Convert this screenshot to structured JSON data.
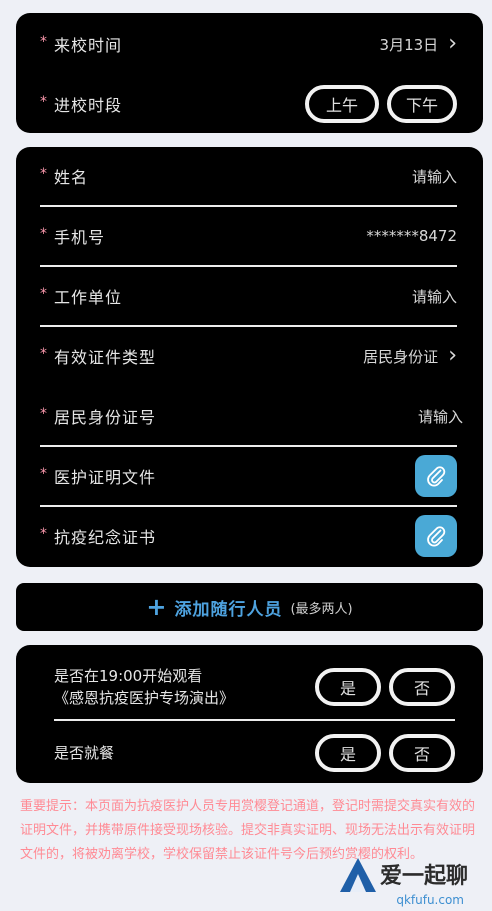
{
  "visit_card": {
    "date_label": "来校时间",
    "date_value": "3月13日",
    "period_label": "进校时段",
    "period_options": [
      "上午",
      "下午"
    ]
  },
  "info_card": {
    "name_label": "姓名",
    "name_placeholder": "请输入",
    "phone_label": "手机号",
    "phone_value": "*******8472",
    "workplace_label": "工作单位",
    "workplace_placeholder": "请输入",
    "id_type_label": "有效证件类型",
    "id_type_value": "居民身份证",
    "id_number_label": "居民身份证号",
    "id_number_placeholder": "请输入",
    "medical_proof_label": "医护证明文件",
    "commemorative_label": "抗疫纪念证书"
  },
  "add_companion": {
    "plus": "+",
    "label": "添加随行人员",
    "note": "(最多两人)"
  },
  "questions": {
    "q1_line1": "是否在19:00开始观看",
    "q1_line2": "《感恩抗疫医护专场演出》",
    "q2": "是否就餐",
    "yes": "是",
    "no": "否"
  },
  "notice": "重要提示：本页面为抗疫医护人员专用赏樱登记通道，登记时需提交真实有效的证明文件，并携带原件接受现场核验。提交非真实证明、现场无法出示有效证明文件的，将被劝离学校，学校保留禁止该证件号今后预约赏樱的权利。",
  "watermark": {
    "text": "爱一起聊",
    "url": "qkfufu.com"
  },
  "colors": {
    "accent": "#4ea3e0",
    "attach_button": "#4aa9d6",
    "notice": "#ff8a94",
    "required": "#ff9ab0"
  }
}
